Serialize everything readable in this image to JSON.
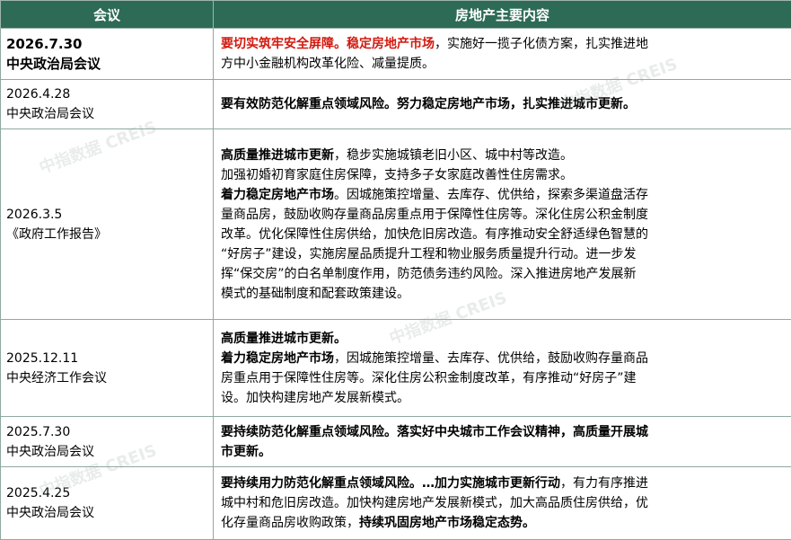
{
  "header": {
    "col_meeting": "会议",
    "col_content": "房地产主要内容"
  },
  "rows": [
    {
      "date": "2026.7.30",
      "name": "中央政治局会议",
      "lines": [
        [
          {
            "t": "要切实筑牢安全屏障。稳定房地产市场",
            "s": "red"
          },
          {
            "t": "，实施好一揽子化债方案，扎实推进地",
            "s": ""
          }
        ],
        [
          {
            "t": "方中小金融机构改革化险、减量提质。",
            "s": ""
          }
        ]
      ]
    },
    {
      "date": "2026.4.28",
      "name": "中央政治局会议",
      "lines": [
        [
          {
            "t": "要有效防范化解重点领域风险。努力稳定房地产市场，扎实推进城市更新。",
            "s": "b"
          }
        ]
      ]
    },
    {
      "date": "2026.3.5",
      "name": "《政府工作报告》",
      "lines": [
        [
          {
            "t": "高质量推进城市更新",
            "s": "b"
          },
          {
            "t": "，稳步实施城镇老旧小区、城中村等改造。",
            "s": ""
          }
        ],
        [
          {
            "t": "加强初婚初育家庭住房保障，支持多子女家庭改善性住房需求。",
            "s": ""
          }
        ],
        [
          {
            "t": "着力稳定房地产市场",
            "s": "b"
          },
          {
            "t": "。因城施策控增量、去库存、优供给，探索多渠道盘活存",
            "s": ""
          }
        ],
        [
          {
            "t": "量商品房，鼓励收购存量商品房重点用于保障性住房等。深化住房公积金制度",
            "s": ""
          }
        ],
        [
          {
            "t": "改革。优化保障性住房供给，加快危旧房改造。有序推动安全舒适绿色智慧的",
            "s": ""
          }
        ],
        [
          {
            "t": "“好房子”建设，实施房屋品质提升工程和物业服务质量提升行动。进一步发",
            "s": ""
          }
        ],
        [
          {
            "t": "挥“保交房”的白名单制度作用，防范债务违约风险。深入推进房地产发展新",
            "s": ""
          }
        ],
        [
          {
            "t": "模式的基础制度和配套政策建设。",
            "s": ""
          }
        ]
      ]
    },
    {
      "date": "2025.12.11",
      "name": "中央经济工作会议",
      "lines": [
        [
          {
            "t": "高质量推进城市更新。",
            "s": "b"
          }
        ],
        [
          {
            "t": "着力稳定房地产市场",
            "s": "b"
          },
          {
            "t": "，因城施策控增量、去库存、优供给，鼓励收购存量商品",
            "s": ""
          }
        ],
        [
          {
            "t": "房重点用于保障性住房等。深化住房公积金制度改革，有序推动“好房子”建",
            "s": ""
          }
        ],
        [
          {
            "t": "设。加快构建房地产发展新模式。",
            "s": ""
          }
        ]
      ]
    },
    {
      "date": "2025.7.30",
      "name": "中央政治局会议",
      "lines": [
        [
          {
            "t": "要持续防范化解重点领域风险。落实好中央城市工作会议精神，高质量开展城",
            "s": "b"
          }
        ],
        [
          {
            "t": "市更新。",
            "s": "b"
          }
        ]
      ]
    },
    {
      "date": "2025.4.25",
      "name": "中央政治局会议",
      "lines": [
        [
          {
            "t": "要持续用力防范化解重点领域风险。…加力实施城市更新行动",
            "s": "b"
          },
          {
            "t": "，有力有序推进",
            "s": ""
          }
        ],
        [
          {
            "t": "城中村和危旧房改造。加快构建房地产发展新模式，加大高品质住房供给，优",
            "s": ""
          }
        ],
        [
          {
            "t": "化存量商品房收购政策，",
            "s": ""
          },
          {
            "t": "持续巩固房地产市场稳定态势。",
            "s": "b"
          }
        ]
      ]
    }
  ]
}
